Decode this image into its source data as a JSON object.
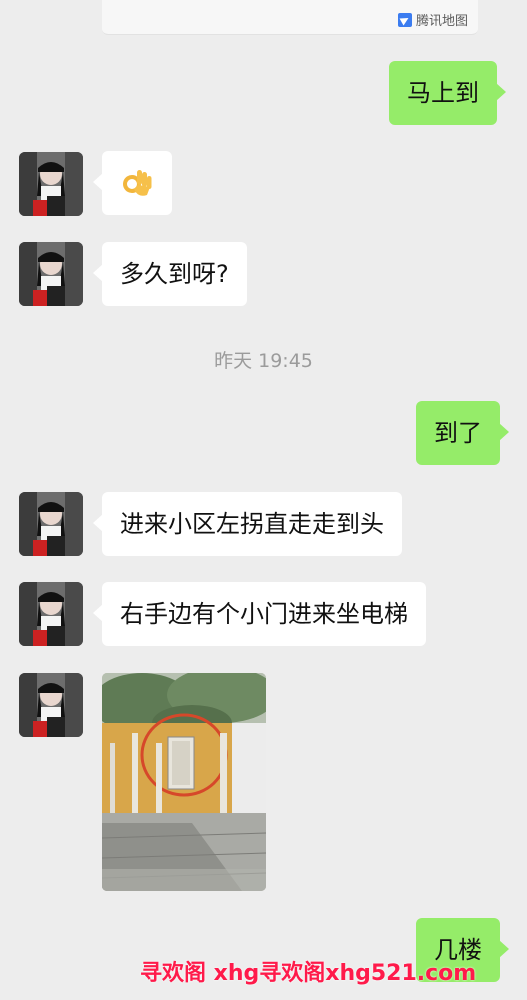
{
  "map_card": {
    "label": "腾讯地图"
  },
  "messages": [
    {
      "side": "right",
      "text": "马上到"
    },
    {
      "side": "left",
      "type": "emoji",
      "emoji": "👌"
    },
    {
      "side": "left",
      "text": "多久到呀?"
    },
    {
      "side": "right",
      "text": "到了"
    },
    {
      "side": "left",
      "text": "进来小区左拐直走走到头"
    },
    {
      "side": "left",
      "text": "右手边有个小门进来坐电梯"
    },
    {
      "side": "left",
      "type": "image"
    },
    {
      "side": "right",
      "text": "几楼"
    }
  ],
  "timestamp": "昨天 19:45",
  "watermark": "寻欢阁 xhg寻欢阁xhg521.com",
  "colors": {
    "background": "#ededed",
    "bubble_left": "#ffffff",
    "bubble_right": "#95ec69",
    "watermark": "#ff1a4a"
  }
}
